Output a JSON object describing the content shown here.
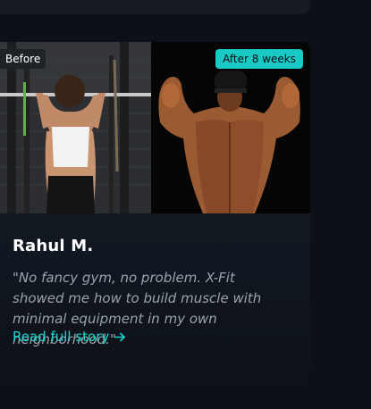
{
  "story": {
    "before_label": "Before",
    "after_label": "After 8 weeks",
    "name": "Rahul M.",
    "quote": "\"No fancy gym, no problem. X-Fit showed me how to build muscle with minimal equipment in my own neighborhood.\"",
    "link_label": "Read full story",
    "cap_text": "",
    "accent_color": "#19c9c4"
  }
}
